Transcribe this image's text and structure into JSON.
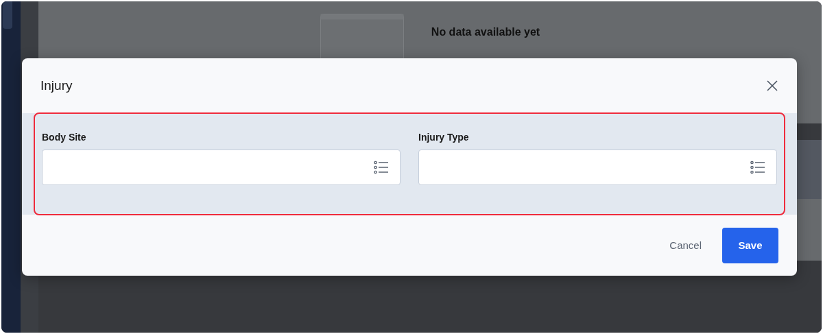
{
  "background": {
    "empty_state": {
      "title": "No data available yet"
    }
  },
  "dialog": {
    "title": "Injury",
    "fields": [
      {
        "label": "Body Site"
      },
      {
        "label": "Injury Type"
      }
    ],
    "highlighted": true,
    "buttons": [
      {
        "label": "Cancel",
        "kind": "secondary"
      },
      {
        "label": "Save",
        "kind": "primary"
      }
    ]
  }
}
